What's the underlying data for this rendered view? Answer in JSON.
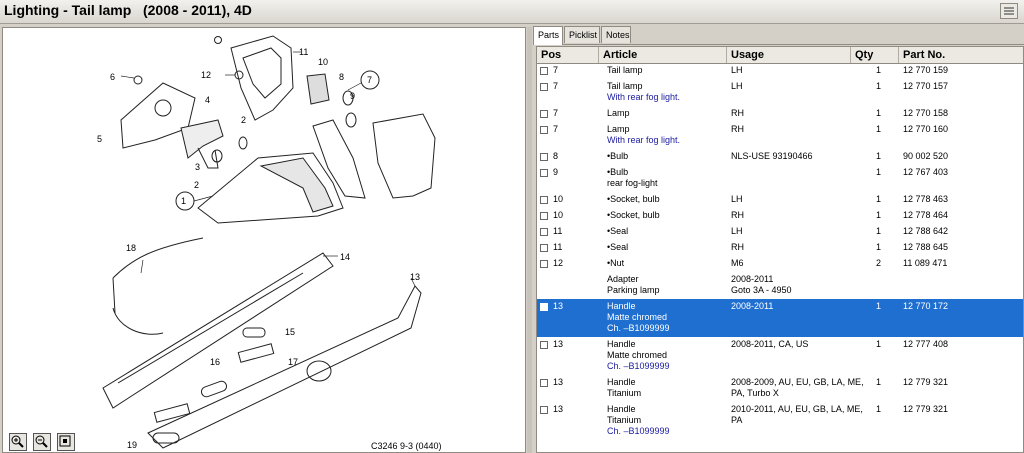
{
  "window": {
    "title": "Lighting - Tail lamp   (2008 - 2011), 4D"
  },
  "diagram": {
    "code": "C3246 9-3 (0440)",
    "callouts": [
      "1",
      "2",
      "3",
      "4",
      "5",
      "6",
      "7",
      "8",
      "9",
      "10",
      "11",
      "12",
      "13",
      "14",
      "15",
      "16",
      "17",
      "18",
      "19"
    ],
    "zoom_buttons": [
      "zoom-in-icon",
      "zoom-out-icon",
      "fit-icon"
    ]
  },
  "tabs": [
    {
      "label": "Parts",
      "active": true
    },
    {
      "label": "Picklist",
      "active": false
    },
    {
      "label": "Notes",
      "active": false
    }
  ],
  "table": {
    "headers": [
      "Pos",
      "Article",
      "Usage",
      "Qty",
      "Part No."
    ],
    "rows": [
      {
        "pos": "7",
        "article": [
          "Tail lamp"
        ],
        "sub": [],
        "usage": [
          "LH"
        ],
        "qty": "1",
        "part": "12 770 159",
        "selected": false
      },
      {
        "pos": "7",
        "article": [
          "Tail lamp"
        ],
        "sub": [
          "With rear fog light."
        ],
        "usage": [
          "LH"
        ],
        "qty": "1",
        "part": "12 770 157",
        "selected": false
      },
      {
        "pos": "7",
        "article": [
          "Lamp"
        ],
        "sub": [],
        "usage": [
          "RH"
        ],
        "qty": "1",
        "part": "12 770 158",
        "selected": false
      },
      {
        "pos": "7",
        "article": [
          "Lamp"
        ],
        "sub": [
          "With rear fog light."
        ],
        "usage": [
          "RH"
        ],
        "qty": "1",
        "part": "12 770 160",
        "selected": false
      },
      {
        "pos": "8",
        "article": [
          "•Bulb"
        ],
        "sub": [],
        "usage": [
          "NLS-USE 93190466"
        ],
        "qty": "1",
        "part": "90 002 520",
        "selected": false
      },
      {
        "pos": "9",
        "article": [
          "•Bulb",
          " rear fog-light"
        ],
        "sub": [],
        "usage": [
          ""
        ],
        "qty": "1",
        "part": "12 767 403",
        "selected": false
      },
      {
        "pos": "10",
        "article": [
          "•Socket, bulb"
        ],
        "sub": [],
        "usage": [
          "LH"
        ],
        "qty": "1",
        "part": "12 778 463",
        "selected": false
      },
      {
        "pos": "10",
        "article": [
          "•Socket, bulb"
        ],
        "sub": [],
        "usage": [
          "RH"
        ],
        "qty": "1",
        "part": "12 778 464",
        "selected": false
      },
      {
        "pos": "11",
        "article": [
          "•Seal"
        ],
        "sub": [],
        "usage": [
          "LH"
        ],
        "qty": "1",
        "part": "12 788 642",
        "selected": false
      },
      {
        "pos": "11",
        "article": [
          "•Seal"
        ],
        "sub": [],
        "usage": [
          "RH"
        ],
        "qty": "1",
        "part": "12 788 645",
        "selected": false
      },
      {
        "pos": "12",
        "article": [
          "•Nut"
        ],
        "sub": [],
        "usage": [
          "M6"
        ],
        "qty": "2",
        "part": "11 089 471",
        "selected": false
      },
      {
        "pos": "",
        "article": [
          "Adapter",
          "Parking lamp"
        ],
        "sub": [],
        "usage": [
          "2008-2011",
          "Goto 3A - 4950"
        ],
        "qty": "",
        "part": "",
        "selected": false,
        "nocheck": true
      },
      {
        "pos": "13",
        "article": [
          "Handle",
          "Matte chromed"
        ],
        "sub": [
          "Ch. –B1099999"
        ],
        "usage": [
          "2008-2011"
        ],
        "qty": "1",
        "part": "12 770 172",
        "selected": true
      },
      {
        "pos": "13",
        "article": [
          "Handle",
          "Matte chromed"
        ],
        "sub": [
          "Ch. –B1099999"
        ],
        "usage": [
          "2008-2011, CA, US"
        ],
        "qty": "1",
        "part": "12 777 408",
        "selected": false
      },
      {
        "pos": "13",
        "article": [
          "Handle",
          "Titanium"
        ],
        "sub": [],
        "usage": [
          "2008-2009, AU, EU, GB, LA, ME,",
          "PA, Turbo X"
        ],
        "qty": "1",
        "part": "12 779 321",
        "selected": false
      },
      {
        "pos": "13",
        "article": [
          "Handle",
          "Titanium"
        ],
        "sub": [
          "Ch. –B1099999"
        ],
        "usage": [
          "2010-2011, AU, EU, GB, LA, ME,",
          "PA"
        ],
        "qty": "1",
        "part": "12 779 321",
        "selected": false
      }
    ]
  },
  "colors": {
    "selection": "#1f6fd0",
    "subtext": "#1a1aa0"
  }
}
